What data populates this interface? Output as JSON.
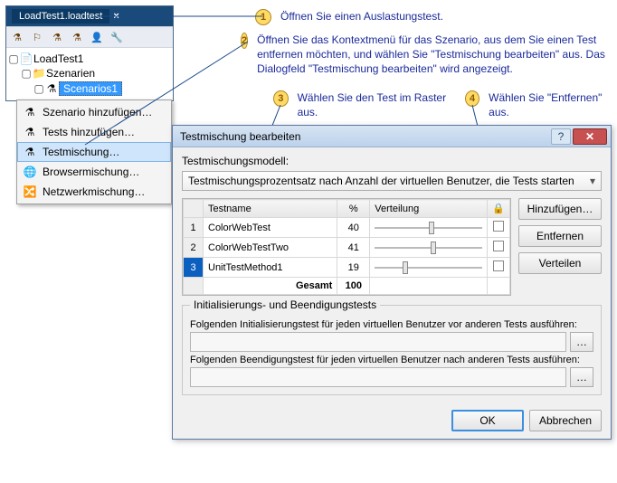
{
  "panel": {
    "tab_title": "LoadTest1.loadtest",
    "tree": {
      "root": "LoadTest1",
      "group": "Szenarien",
      "selected": "Scenarios1"
    }
  },
  "context_menu": {
    "items": [
      "Szenario hinzufügen…",
      "Tests hinzufügen…",
      "Testmischung…",
      "Browsermischung…",
      "Netzwerkmischung…"
    ],
    "highlight_index": 2
  },
  "callouts": {
    "c1": "Öffnen Sie einen Auslastungstest.",
    "c2": "Öffnen Sie das Kontextmenü für das Szenario, aus dem Sie einen Test entfernen möchten, und wählen Sie \"Testmischung bearbeiten\" aus. Das Dialogfeld \"Testmischung bearbeiten\" wird angezeigt.",
    "c3": "Wählen Sie den Test im Raster aus.",
    "c4": "Wählen Sie \"Entfernen\" aus."
  },
  "dialog": {
    "title": "Testmischung bearbeiten",
    "model_label": "Testmischungsmodell:",
    "model_value": "Testmischungsprozentsatz nach Anzahl der virtuellen Benutzer, die Tests starten",
    "columns": {
      "name": "Testname",
      "pct": "%",
      "dist": "Verteilung",
      "lock": "🔒"
    },
    "rows": [
      {
        "idx": "1",
        "name": "ColorWebTest",
        "pct": "40",
        "thumb": 50,
        "selected": false
      },
      {
        "idx": "2",
        "name": "ColorWebTestTwo",
        "pct": "41",
        "thumb": 52,
        "selected": false
      },
      {
        "idx": "3",
        "name": "UnitTestMethod1",
        "pct": "19",
        "thumb": 26,
        "selected": true
      }
    ],
    "total_label": "Gesamt",
    "total_value": "100",
    "buttons": {
      "add": "Hinzufügen…",
      "remove": "Entfernen",
      "distribute": "Verteilen"
    },
    "fieldset": {
      "legend": "Initialisierungs- und Beendigungstests",
      "init_label": "Folgenden Initialisierungstest für jeden virtuellen Benutzer vor anderen Tests ausführen:",
      "end_label": "Folgenden Beendigungstest für jeden virtuellen Benutzer nach anderen Tests ausführen:",
      "browse": "…"
    },
    "ok": "OK",
    "cancel": "Abbrechen"
  },
  "chart_data": {
    "type": "table",
    "title": "Testmischung",
    "categories": [
      "ColorWebTest",
      "ColorWebTestTwo",
      "UnitTestMethod1"
    ],
    "values": [
      40,
      41,
      19
    ],
    "total": 100
  }
}
